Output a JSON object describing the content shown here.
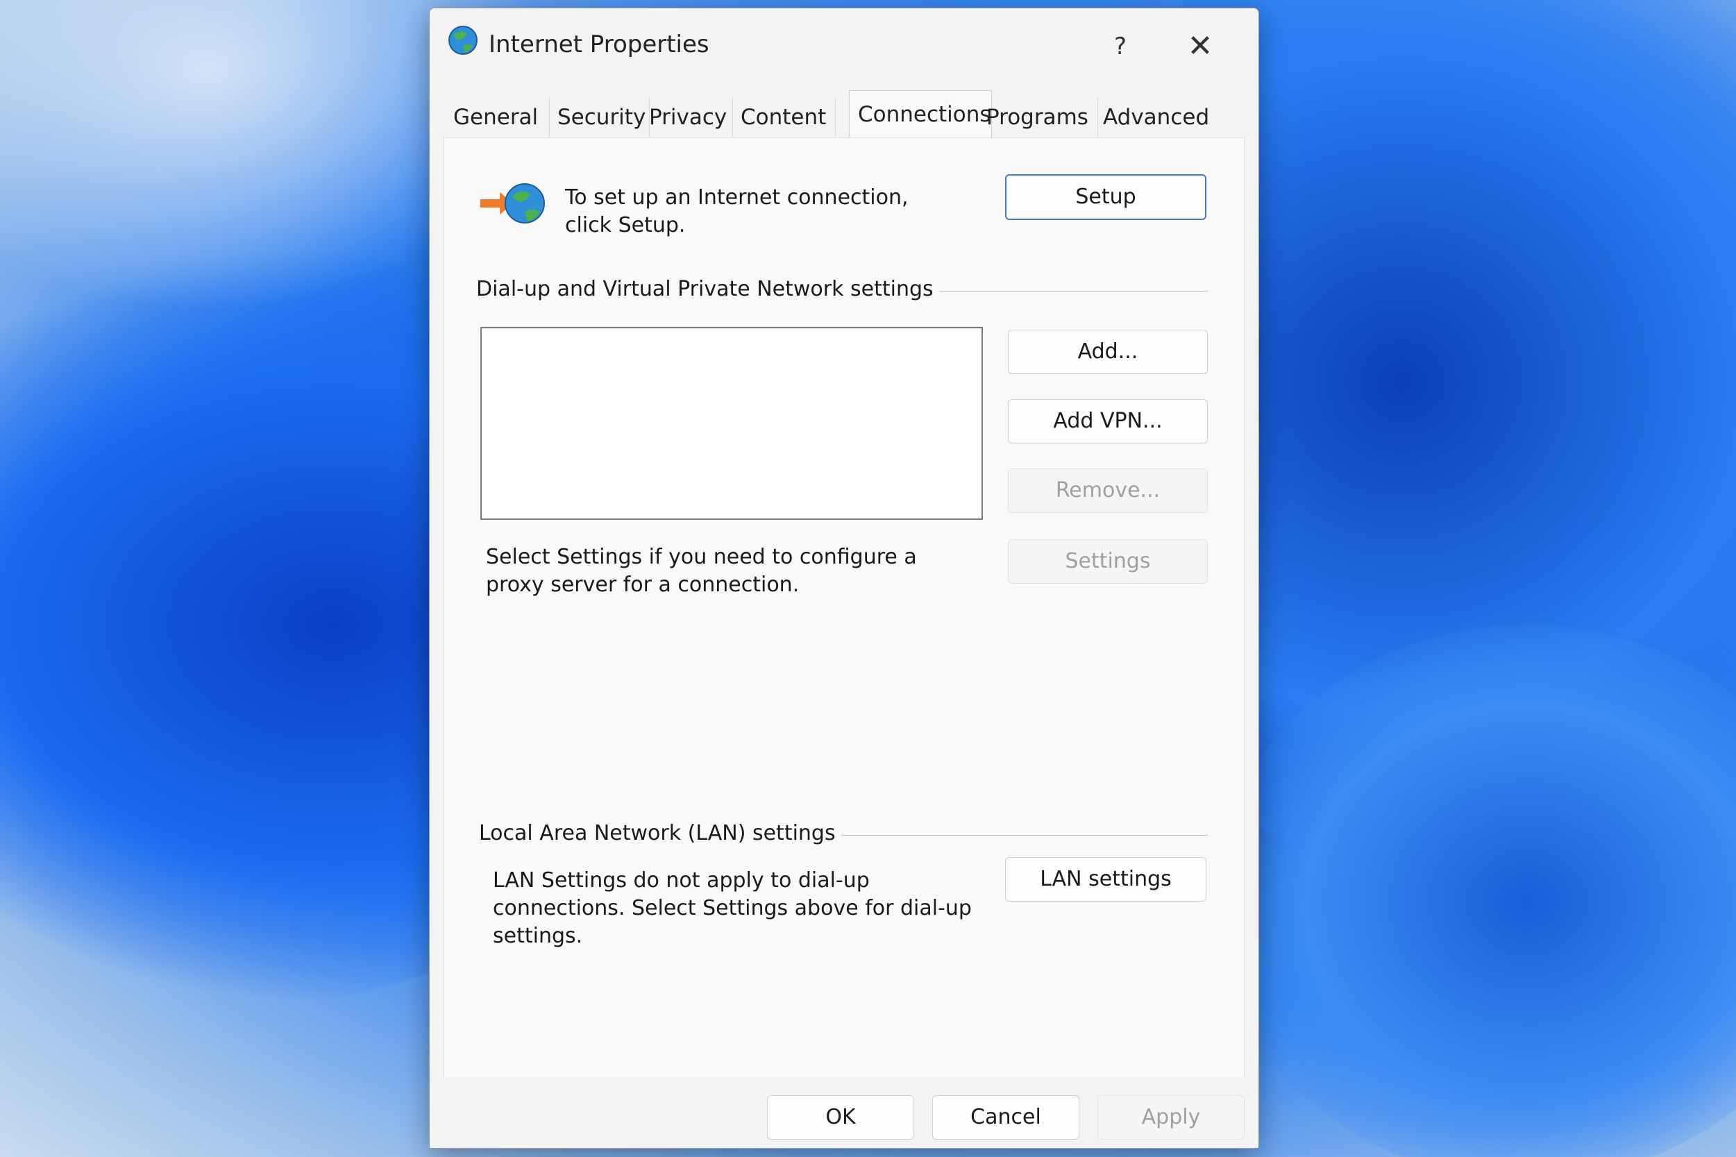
{
  "window": {
    "title": "Internet Properties",
    "help_label": "?",
    "close_label": "✕"
  },
  "tabs": [
    {
      "label": "General"
    },
    {
      "label": "Security"
    },
    {
      "label": "Privacy"
    },
    {
      "label": "Content"
    },
    {
      "label": "Connections"
    },
    {
      "label": "Programs"
    },
    {
      "label": "Advanced"
    }
  ],
  "active_tab": "Connections",
  "setup": {
    "text": "To set up an Internet connection, click Setup.",
    "button": "Setup"
  },
  "dialup": {
    "group_label": "Dial-up and Virtual Private Network settings",
    "add_button": "Add...",
    "add_vpn_button": "Add VPN...",
    "remove_button": "Remove...",
    "settings_button": "Settings",
    "proxy_text": "Select Settings if you need to configure a proxy server for a connection."
  },
  "lan": {
    "group_label": "Local Area Network (LAN) settings",
    "text": "LAN Settings do not apply to dial-up connections. Select Settings above for dial-up settings.",
    "button": "LAN settings"
  },
  "footer": {
    "ok": "OK",
    "cancel": "Cancel",
    "apply": "Apply"
  },
  "colors": {
    "accent": "#3a7bd5",
    "wallpaper": "#1552c9"
  }
}
